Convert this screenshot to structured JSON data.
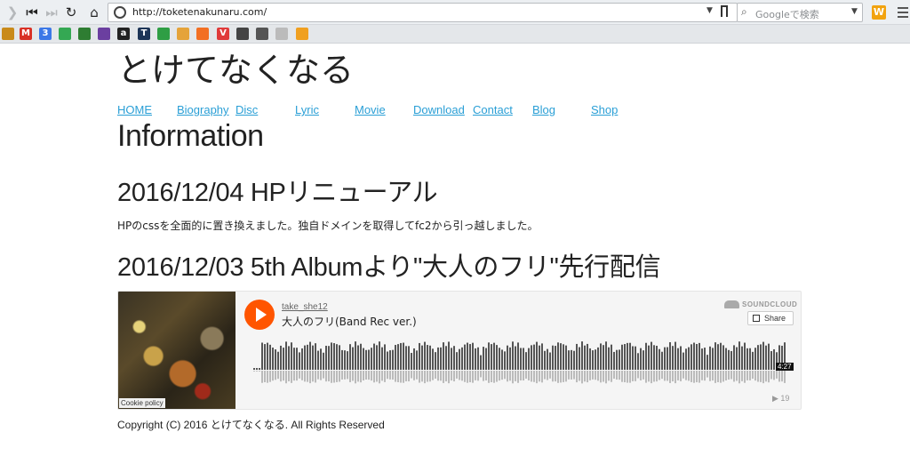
{
  "browser": {
    "url": "http://toketenakunaru.com/",
    "search_placeholder": "Googleで検索",
    "extension_label": "W",
    "bookmarks": [
      {
        "name": "sushi-icon",
        "color": "#c98a1a"
      },
      {
        "name": "gmail-icon",
        "color": "#d93025",
        "glyph": "M"
      },
      {
        "name": "calendar-icon",
        "color": "#3b78e7",
        "glyph": "3"
      },
      {
        "name": "maps-icon",
        "color": "#34a853"
      },
      {
        "name": "tool-icon",
        "color": "#2e7d32"
      },
      {
        "name": "bookmark-o-icon",
        "color": "#6b3fa0"
      },
      {
        "name": "amazon-icon",
        "color": "#222222",
        "glyph": "a"
      },
      {
        "name": "t-icon",
        "color": "#1d3557",
        "glyph": "T"
      },
      {
        "name": "stats-icon",
        "color": "#2e9e44"
      },
      {
        "name": "check-icon",
        "color": "#e5a33a"
      },
      {
        "name": "soundcloud-icon",
        "color": "#f26f23"
      },
      {
        "name": "vivaldi-icon",
        "color": "#e03a3a",
        "glyph": "V"
      },
      {
        "name": "info-icon",
        "color": "#444444"
      },
      {
        "name": "cow-icon",
        "color": "#555555"
      },
      {
        "name": "page-icon",
        "color": "#bbbbbb"
      },
      {
        "name": "chart-icon",
        "color": "#f0a020"
      }
    ]
  },
  "site": {
    "title": "とけてなくなる",
    "nav": [
      "HOME",
      "Biography",
      "Disc",
      "Lyric",
      "Movie",
      "Download",
      "Contact",
      "Blog",
      "Shop"
    ]
  },
  "main": {
    "section_title": "Information",
    "news": [
      {
        "heading": "2016/12/04 HPリニューアル",
        "body": "HPのcssを全面的に置き換えました。独自ドメインを取得してfc2から引っ越しました。"
      },
      {
        "heading": "2016/12/03 5th Albumより\"大人のフリ\"先行配信"
      }
    ]
  },
  "player": {
    "user": "take_she12",
    "track": "大人のフリ(Band Rec ver.)",
    "brand": "SOUNDCLOUD",
    "share_label": "Share",
    "duration": "4:27",
    "plays": "▶ 19",
    "cookie_label": "Cookie policy"
  },
  "footer": {
    "copyright": "Copyright (C) 2016 とけてなくなる. All Rights Reserved"
  }
}
